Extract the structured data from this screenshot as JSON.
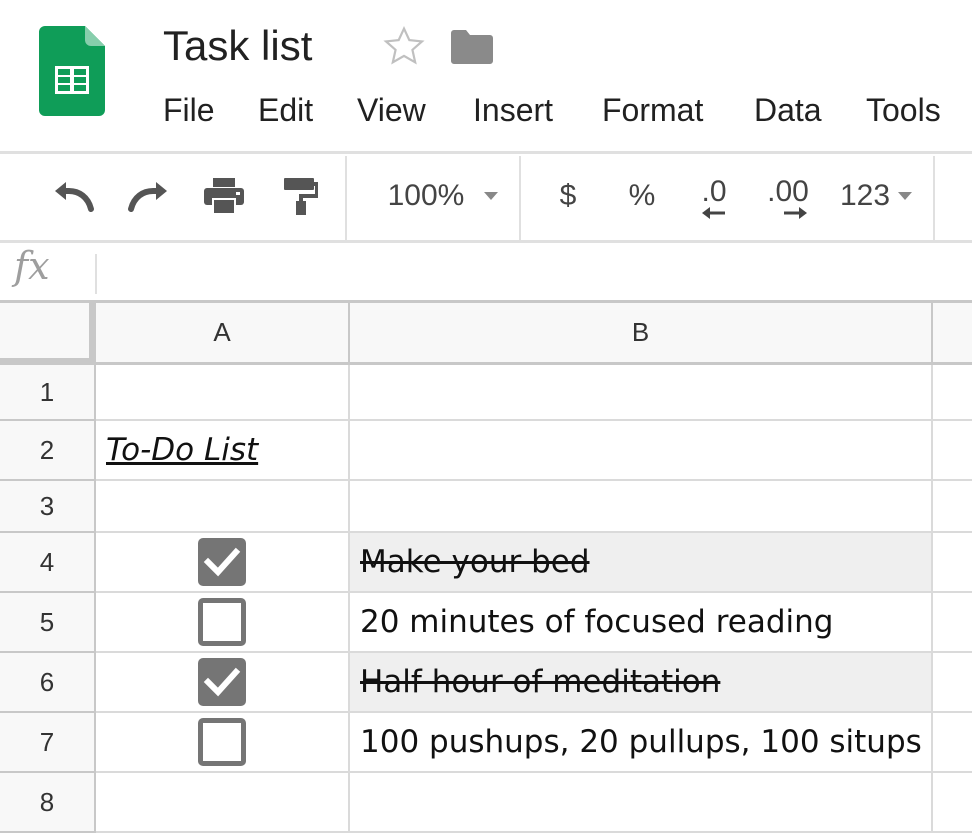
{
  "app": {
    "title": "Task list",
    "colors": {
      "sheets_green": "#0F9D58",
      "sheets_dark_green": "#0B8043",
      "icon_gray": "#757575"
    }
  },
  "header_icons": [
    "sheets-logo-icon",
    "star-icon",
    "folder-icon"
  ],
  "menu": [
    {
      "id": "file",
      "label": "File"
    },
    {
      "id": "edit",
      "label": "Edit"
    },
    {
      "id": "view",
      "label": "View"
    },
    {
      "id": "insert",
      "label": "Insert"
    },
    {
      "id": "format",
      "label": "Format"
    },
    {
      "id": "data",
      "label": "Data"
    },
    {
      "id": "tools",
      "label": "Tools"
    }
  ],
  "toolbar": {
    "icons": [
      "undo-icon",
      "redo-icon",
      "print-icon",
      "paint-format-icon"
    ],
    "zoom": "100%",
    "currency": "$",
    "percent": "%",
    "decrease_decimal": ".0",
    "increase_decimal": ".00",
    "more_formats": "123"
  },
  "formula_bar": {
    "label": "fx",
    "value": ""
  },
  "sheet": {
    "columns": [
      "A",
      "B"
    ],
    "rows": [
      {
        "num": "1",
        "checkbox": null,
        "text": "",
        "strikethrough": false
      },
      {
        "num": "2",
        "title": "To-Do List",
        "checkbox": null,
        "text": "",
        "strikethrough": false
      },
      {
        "num": "3",
        "checkbox": null,
        "text": "",
        "strikethrough": false
      },
      {
        "num": "4",
        "checkbox": true,
        "text": "Make your bed",
        "strikethrough": true
      },
      {
        "num": "5",
        "checkbox": false,
        "text": "20 minutes of focused reading",
        "strikethrough": false
      },
      {
        "num": "6",
        "checkbox": true,
        "text": "Half hour of meditation",
        "strikethrough": true
      },
      {
        "num": "7",
        "checkbox": false,
        "text": "100 pushups, 20 pullups, 100 situps",
        "strikethrough": false
      },
      {
        "num": "8",
        "checkbox": null,
        "text": "",
        "strikethrough": false
      }
    ]
  }
}
